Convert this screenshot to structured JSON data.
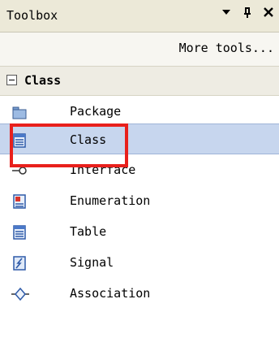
{
  "window": {
    "title": "Toolbox",
    "controls": [
      {
        "name": "dropdown-arrow-icon",
        "glyph": "▼"
      },
      {
        "name": "pin-icon",
        "glyph": "ᵖ"
      },
      {
        "name": "close-icon",
        "glyph": "✕"
      }
    ]
  },
  "toolbar": {
    "more_tools_label": "More tools..."
  },
  "group": {
    "label": "Class",
    "expanded": true
  },
  "items": [
    {
      "label": "Package",
      "icon": "package-icon",
      "selected": false
    },
    {
      "label": "Class",
      "icon": "class-icon",
      "selected": true
    },
    {
      "label": "Interface",
      "icon": "interface-icon",
      "selected": false
    },
    {
      "label": "Enumeration",
      "icon": "enumeration-icon",
      "selected": false
    },
    {
      "label": "Table",
      "icon": "table-icon",
      "selected": false
    },
    {
      "label": "Signal",
      "icon": "signal-icon",
      "selected": false
    },
    {
      "label": "Association",
      "icon": "association-icon",
      "selected": false
    }
  ],
  "colors": {
    "highlight_border": "#e8201c",
    "selected_background": "#c7d6ee",
    "titlebar_background": "#ece9d8"
  }
}
